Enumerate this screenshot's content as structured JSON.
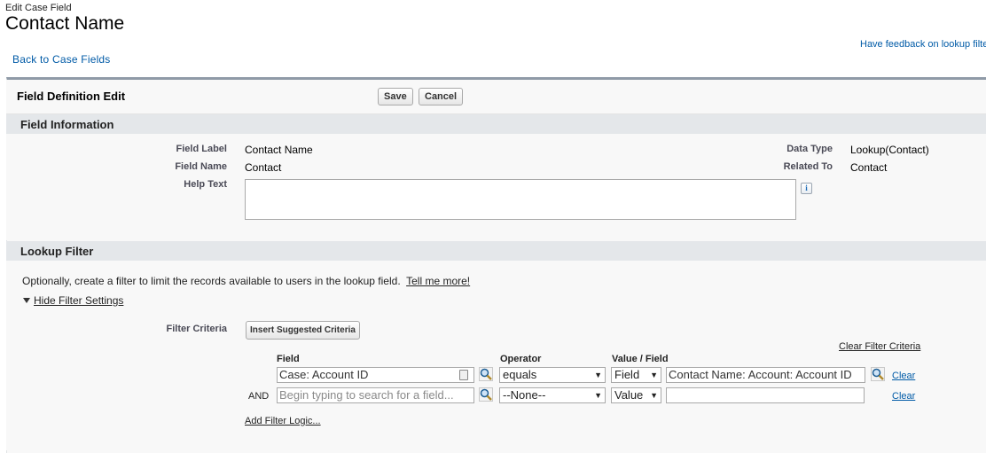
{
  "header": {
    "subtitle": "Edit Case Field",
    "title": "Contact Name",
    "back_link": "Back to Case Fields",
    "feedback_link": "Have feedback on lookup filters?"
  },
  "edit_panel": {
    "title": "Field Definition Edit",
    "save_label": "Save",
    "cancel_label": "Cancel"
  },
  "field_info": {
    "section_title": "Field Information",
    "field_label_label": "Field Label",
    "field_label_value": "Contact Name",
    "field_name_label": "Field Name",
    "field_name_value": "Contact",
    "help_text_label": "Help Text",
    "help_text_value": "",
    "data_type_label": "Data Type",
    "data_type_value": "Lookup(Contact)",
    "related_to_label": "Related To",
    "related_to_value": "Contact",
    "info_icon": "i"
  },
  "lookup_filter": {
    "section_title": "Lookup Filter",
    "description": "Optionally, create a filter to limit the records available to users in the lookup field.",
    "tell_me_more": "Tell me more!",
    "hide_settings": "Hide Filter Settings",
    "filter_criteria_label": "Filter Criteria",
    "insert_suggested": "Insert Suggested Criteria",
    "clear_filter_criteria": "Clear Filter Criteria",
    "columns": {
      "field": "Field",
      "operator": "Operator",
      "value_field": "Value / Field"
    },
    "rows": [
      {
        "prefix": "",
        "field_value": "Case: Account ID",
        "operator": "equals",
        "value_type": "Field",
        "value": "Contact Name: Account: Account ID",
        "clear": "Clear"
      },
      {
        "prefix": "AND",
        "field_placeholder": "Begin typing to search for a field...",
        "operator": "--None--",
        "value_type": "Value",
        "value": "",
        "clear": "Clear"
      }
    ],
    "add_filter_logic": "Add Filter Logic..."
  },
  "icons": {
    "lookup": "magnifier-icon",
    "caret": "▼"
  }
}
